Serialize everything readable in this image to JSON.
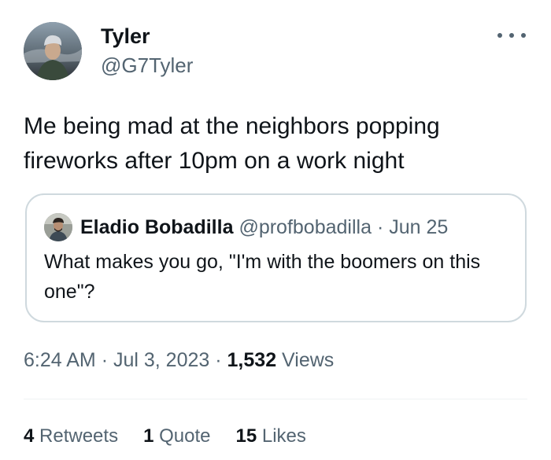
{
  "tweet": {
    "author": {
      "name": "Tyler",
      "handle": "@G7Tyler",
      "avatar_icon": "user-avatar"
    },
    "more_icon": "more-options-icon",
    "text": "Me being mad at the neighbors popping fireworks after 10pm on a work night",
    "quote": {
      "author_name": "Eladio Bobadilla",
      "author_handle": "@profbobadilla",
      "separator": "·",
      "date": "Jun 25",
      "text": "What makes you go, \"I'm with the boomers on this one\"?"
    },
    "meta": {
      "time": "6:24 AM",
      "separator": "·",
      "date": "Jul 3, 2023",
      "views_count": "1,532",
      "views_label": "Views"
    },
    "stats": {
      "retweets_count": "4",
      "retweets_label": "Retweets",
      "quotes_count": "1",
      "quotes_label": "Quote",
      "likes_count": "15",
      "likes_label": "Likes"
    }
  },
  "colors": {
    "text_primary": "#0f1419",
    "text_secondary": "#536471",
    "border": "#cfd9de",
    "divider": "#eff3f4"
  }
}
